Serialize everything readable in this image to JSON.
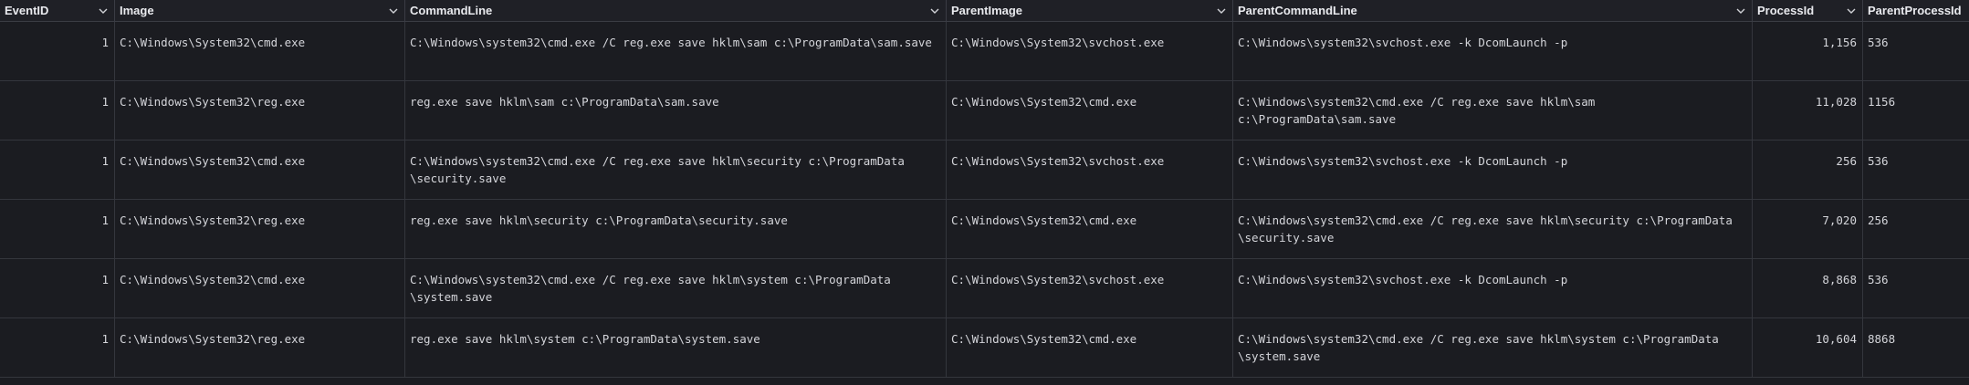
{
  "columns": [
    {
      "label": "EventID"
    },
    {
      "label": "Image"
    },
    {
      "label": "CommandLine"
    },
    {
      "label": "ParentImage"
    },
    {
      "label": "ParentCommandLine"
    },
    {
      "label": "ProcessId"
    },
    {
      "label": "ParentProcessId"
    }
  ],
  "icons": {
    "column_menu": "chevron-down-icon"
  },
  "colors": {
    "background": "#1b1c21",
    "header_bg": "#1f2026",
    "grid_line": "#34363d",
    "text": "#d4d5da"
  },
  "rows": [
    {
      "event_id": "1",
      "image": "C:\\Windows\\System32\\cmd.exe",
      "command_line": "C:\\Windows\\system32\\cmd.exe /C reg.exe save hklm\\sam c:\\ProgramData\\sam.save",
      "parent_image": "C:\\Windows\\System32\\svchost.exe",
      "parent_command_line": "C:\\Windows\\system32\\svchost.exe -k DcomLaunch -p",
      "process_id": "1,156",
      "parent_process_id": "536"
    },
    {
      "event_id": "1",
      "image": "C:\\Windows\\System32\\reg.exe",
      "command_line": "reg.exe save hklm\\sam c:\\ProgramData\\sam.save",
      "parent_image": "C:\\Windows\\System32\\cmd.exe",
      "parent_command_line": "C:\\Windows\\system32\\cmd.exe /C reg.exe save hklm\\sam c:\\ProgramData\\sam.save",
      "process_id": "11,028",
      "parent_process_id": "1156"
    },
    {
      "event_id": "1",
      "image": "C:\\Windows\\System32\\cmd.exe",
      "command_line": "C:\\Windows\\system32\\cmd.exe /C reg.exe save hklm\\security c:\\ProgramData\n\\security.save",
      "parent_image": "C:\\Windows\\System32\\svchost.exe",
      "parent_command_line": "C:\\Windows\\system32\\svchost.exe -k DcomLaunch -p",
      "process_id": "256",
      "parent_process_id": "536"
    },
    {
      "event_id": "1",
      "image": "C:\\Windows\\System32\\reg.exe",
      "command_line": "reg.exe save hklm\\security c:\\ProgramData\\security.save",
      "parent_image": "C:\\Windows\\System32\\cmd.exe",
      "parent_command_line": "C:\\Windows\\system32\\cmd.exe /C reg.exe save hklm\\security c:\\ProgramData\n\\security.save",
      "process_id": "7,020",
      "parent_process_id": "256"
    },
    {
      "event_id": "1",
      "image": "C:\\Windows\\System32\\cmd.exe",
      "command_line": "C:\\Windows\\system32\\cmd.exe /C reg.exe save hklm\\system c:\\ProgramData\n\\system.save",
      "parent_image": "C:\\Windows\\System32\\svchost.exe",
      "parent_command_line": "C:\\Windows\\system32\\svchost.exe -k DcomLaunch -p",
      "process_id": "8,868",
      "parent_process_id": "536"
    },
    {
      "event_id": "1",
      "image": "C:\\Windows\\System32\\reg.exe",
      "command_line": "reg.exe save hklm\\system c:\\ProgramData\\system.save",
      "parent_image": "C:\\Windows\\System32\\cmd.exe",
      "parent_command_line": "C:\\Windows\\system32\\cmd.exe /C reg.exe save hklm\\system c:\\ProgramData\n\\system.save",
      "process_id": "10,604",
      "parent_process_id": "8868"
    }
  ]
}
